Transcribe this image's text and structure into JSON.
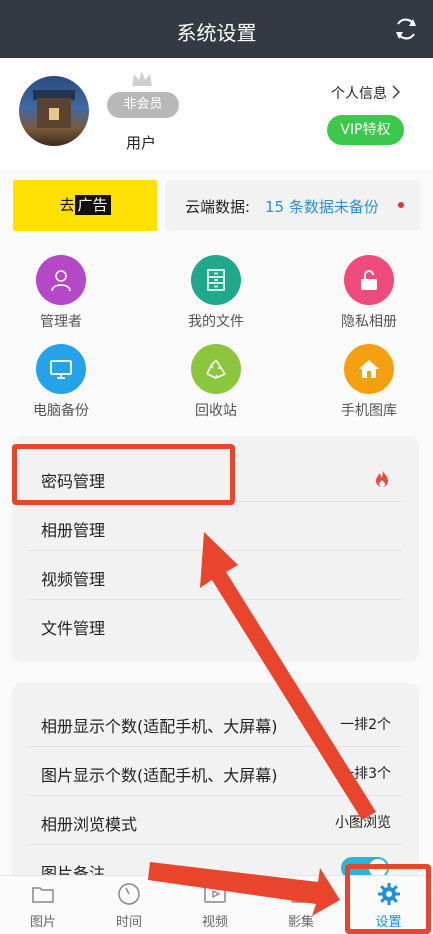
{
  "header": {
    "title": "系统设置",
    "refresh_icon": "refresh-icon"
  },
  "profile": {
    "membership": "非会员",
    "username": "用户",
    "personal_info": "个人信息",
    "vip_button": "VIP特权"
  },
  "promo": {
    "ad_prefix": "去",
    "ad_chip": "广告",
    "cloud_label": "云端数据:",
    "cloud_value": "15 条数据未备份"
  },
  "grid": [
    {
      "label": "管理者",
      "icon": "user-icon",
      "color": "#b548c6"
    },
    {
      "label": "我的文件",
      "icon": "file-cabinet-icon",
      "color": "#1fa88c"
    },
    {
      "label": "隐私相册",
      "icon": "unlock-icon",
      "color": "#ee4a7a"
    },
    {
      "label": "电脑备份",
      "icon": "monitor-icon",
      "color": "#25a3e8"
    },
    {
      "label": "回收站",
      "icon": "recycle-icon",
      "color": "#8cc63f"
    },
    {
      "label": "手机图库",
      "icon": "home-icon",
      "color": "#f5a011"
    }
  ],
  "management": [
    {
      "label": "密码管理",
      "icon": "fire-icon"
    },
    {
      "label": "相册管理"
    },
    {
      "label": "视频管理"
    },
    {
      "label": "文件管理"
    }
  ],
  "display": [
    {
      "label": "相册显示个数(适配手机、大屏幕)",
      "value": "一排2个"
    },
    {
      "label": "图片显示个数(适配手机、大屏幕)",
      "value": "一排3个"
    },
    {
      "label": "相册浏览模式",
      "value": "小图浏览"
    },
    {
      "label": "图片备注",
      "toggle": true
    }
  ],
  "tabs": [
    {
      "label": "图片",
      "icon": "folder-icon",
      "active": false
    },
    {
      "label": "时间",
      "icon": "clock-icon",
      "active": false
    },
    {
      "label": "视频",
      "icon": "video-icon",
      "active": false
    },
    {
      "label": "影集",
      "icon": "album-icon",
      "active": false
    },
    {
      "label": "设置",
      "icon": "gear-icon",
      "active": true
    }
  ],
  "colors": {
    "titlebar": "#333a44",
    "accent": "#1e8fd8",
    "vip": "#3cc84a",
    "ad": "#ffe100",
    "annotation": "#e8452c"
  }
}
